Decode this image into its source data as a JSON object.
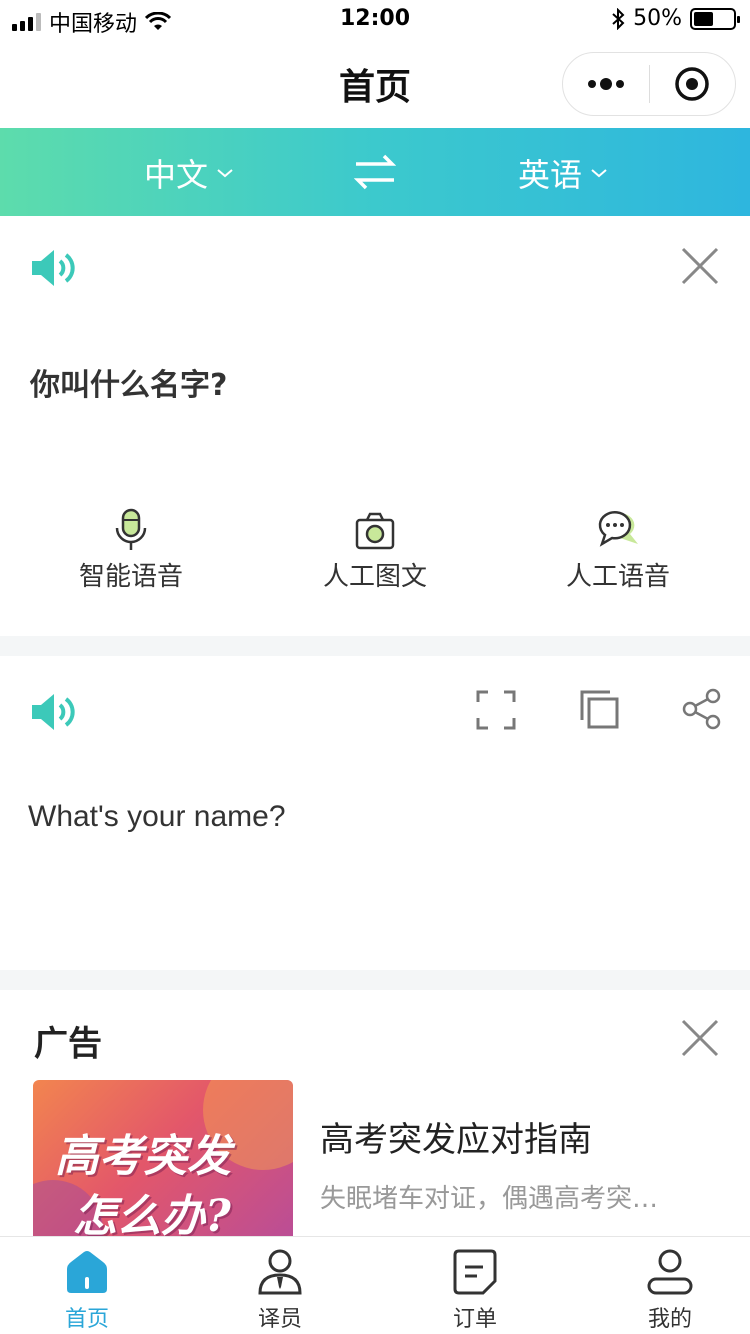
{
  "status_bar": {
    "carrier": "中国移动",
    "time": "12:00",
    "battery": "50%",
    "battery_level": 0.5
  },
  "nav": {
    "title": "首页"
  },
  "language": {
    "source": "中文",
    "target": "英语"
  },
  "input_card": {
    "text": "你叫什么名字?",
    "tools": [
      {
        "label": "智能语音",
        "icon": "microphone-icon"
      },
      {
        "label": "人工图文",
        "icon": "camera-icon"
      },
      {
        "label": "人工语音",
        "icon": "chat-bubble-icon"
      }
    ]
  },
  "output_card": {
    "text": "What's your name?"
  },
  "ad": {
    "label": "广告",
    "image_text_line1": "高考突发",
    "image_text_line2": "怎么办?",
    "title": "高考突发应对指南",
    "description": "失眠堵车对证，偶遇高考突…"
  },
  "tabs": [
    {
      "label": "首页",
      "icon": "home-icon",
      "active": true
    },
    {
      "label": "译员",
      "icon": "translator-icon",
      "active": false
    },
    {
      "label": "订单",
      "icon": "order-icon",
      "active": false
    },
    {
      "label": "我的",
      "icon": "profile-icon",
      "active": false
    }
  ],
  "colors": {
    "accent": "#2aa6d8",
    "gradient_start": "#5ddcac",
    "gradient_end": "#2eb6de",
    "speaker": "#3cc9b9"
  }
}
